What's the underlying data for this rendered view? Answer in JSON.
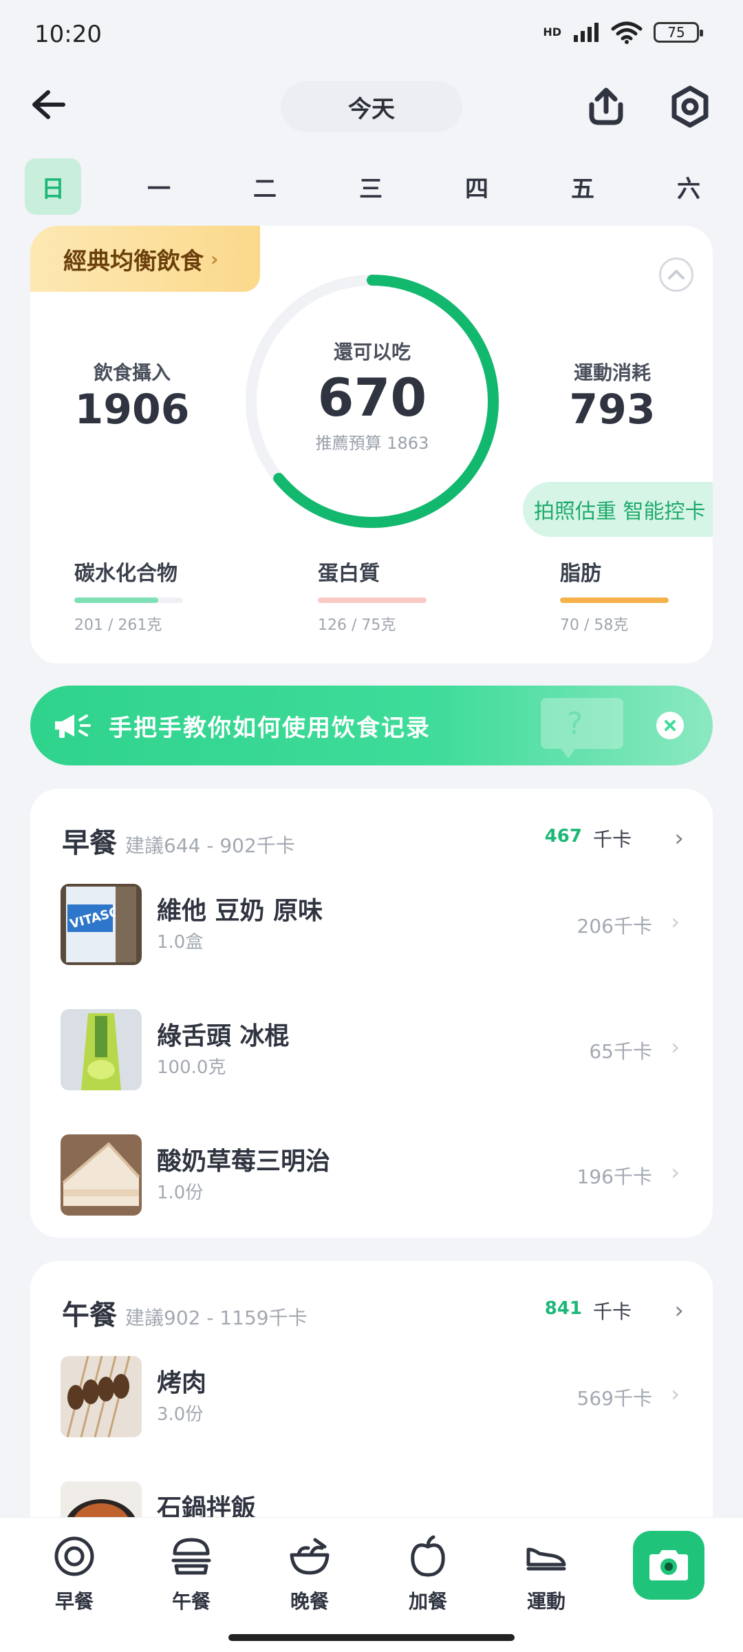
{
  "status_bar": {
    "time": "10:20",
    "network": "HD",
    "battery": "75"
  },
  "header": {
    "title": "今天"
  },
  "week": {
    "days": [
      "日",
      "一",
      "二",
      "三",
      "四",
      "五",
      "六"
    ],
    "active_index": 0
  },
  "summary": {
    "plan_label": "經典均衡飲食",
    "intake_label": "飲食攝入",
    "intake_value": "1906",
    "remaining_label": "還可以吃",
    "remaining_value": "670",
    "budget_text": "推薦預算 1863",
    "burn_label": "運動消耗",
    "burn_value": "793",
    "photo_tag": "拍照估重 智能控卡",
    "ring_progress": 0.64,
    "macros": [
      {
        "label": "碳水化合物",
        "value": "201 / 261克",
        "progress": 0.77,
        "color": "#7fe0b5"
      },
      {
        "label": "蛋白質",
        "value": "126 / 75克",
        "progress": 1.0,
        "color": "#f9c9c4"
      },
      {
        "label": "脂肪",
        "value": "70 / 58克",
        "progress": 1.0,
        "color": "#f5b24c"
      }
    ]
  },
  "banner": {
    "text": "手把手教你如何使用饮食记录"
  },
  "meals": [
    {
      "title": "早餐",
      "suggest": "建議644 - 902千卡",
      "total": "467",
      "unit": "千卡",
      "items": [
        {
          "name": "維他 豆奶 原味",
          "qty": "1.0盒",
          "kcal": "206千卡",
          "thumb": "soy-milk-carton"
        },
        {
          "name": "綠舌頭 冰棍",
          "qty": "100.0克",
          "kcal": "65千卡",
          "thumb": "green-ice-pop"
        },
        {
          "name": "酸奶草莓三明治",
          "qty": "1.0份",
          "kcal": "196千卡",
          "thumb": "sandwich"
        }
      ]
    },
    {
      "title": "午餐",
      "suggest": "建議902 - 1159千卡",
      "total": "841",
      "unit": "千卡",
      "items": [
        {
          "name": "烤肉",
          "qty": "3.0份",
          "kcal": "569千卡",
          "thumb": "skewers"
        },
        {
          "name": "石鍋拌飯",
          "qty": "",
          "kcal": "",
          "thumb": "bibimbap"
        }
      ]
    }
  ],
  "bottom_nav": [
    {
      "label": "早餐",
      "icon": "egg-icon"
    },
    {
      "label": "午餐",
      "icon": "burger-icon"
    },
    {
      "label": "晚餐",
      "icon": "bowl-icon"
    },
    {
      "label": "加餐",
      "icon": "apple-icon"
    },
    {
      "label": "運動",
      "icon": "shoe-icon"
    }
  ],
  "colors": {
    "accent": "#1db877",
    "ring": "#13b86f",
    "banner": "#2fd38c"
  }
}
